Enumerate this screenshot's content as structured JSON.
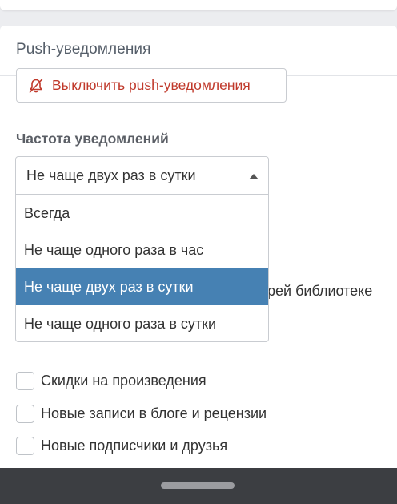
{
  "panel": {
    "title": "Push-уведомления"
  },
  "disable_button": {
    "label": "Выключить push-уведомления",
    "icon": "bell-off-icon",
    "color": "#c0392b"
  },
  "frequency": {
    "label": "Частота уведомлений",
    "selected": "Не чаще двух раз в сутки",
    "options": [
      "Всегда",
      "Не чаще одного раза в час",
      "Не чаще двух раз в сутки",
      "Не чаще одного раза в сутки"
    ],
    "highlight_color": "#4681b3"
  },
  "partially_hidden_text": "рей библиотеке",
  "checkboxes": [
    {
      "label": "Скидки на произведения",
      "checked": false
    },
    {
      "label": "Новые записи в блоге и рецензии",
      "checked": false
    },
    {
      "label": "Новые подписчики и друзья",
      "checked": false
    }
  ]
}
